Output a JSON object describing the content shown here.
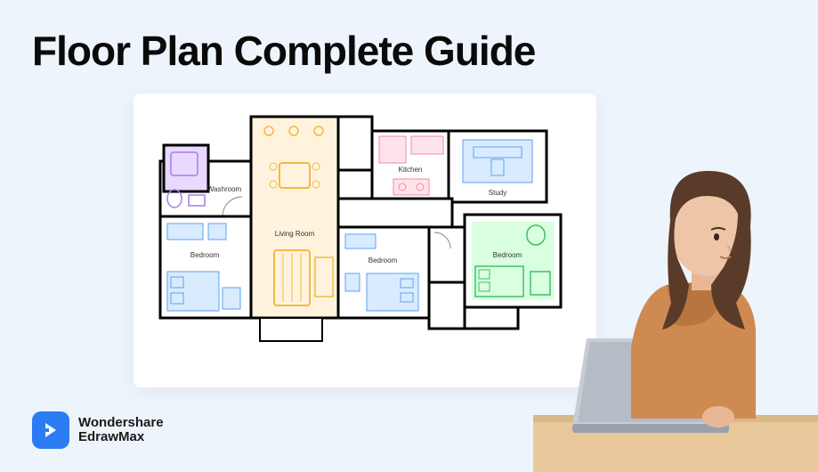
{
  "title": "Floor Plan Complete Guide",
  "logo": {
    "brand": "Wondershare",
    "product": "EdrawMax"
  },
  "floorplan": {
    "rooms": {
      "washroom": "Washroom",
      "living": "Living Room",
      "kitchen": "Kitchen",
      "study": "Study",
      "bedroom1": "Bedroom",
      "bedroom2": "Bedroom",
      "bedroom3": "Bedroom"
    },
    "colors": {
      "washroom": "#e8d9ff",
      "living": "#fff3dd",
      "kitchen": "#ffe3ea",
      "study": "#d9ebff",
      "bedroom_blue": "#d9ebff",
      "bedroom_green": "#d9ffe0",
      "wall": "#000000"
    }
  }
}
